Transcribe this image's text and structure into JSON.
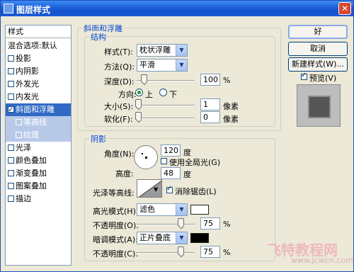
{
  "window": {
    "title": "图层样式"
  },
  "left_list": {
    "header": "样式",
    "items": [
      {
        "label": "混合选项:默认",
        "check": false
      },
      {
        "label": "投影",
        "check": true,
        "on": false
      },
      {
        "label": "内阴影",
        "check": true,
        "on": false
      },
      {
        "label": "外发光",
        "check": true,
        "on": false
      },
      {
        "label": "内发光",
        "check": true,
        "on": false
      },
      {
        "label": "斜面和浮雕",
        "check": true,
        "on": true,
        "selected": true
      },
      {
        "label": "等高线",
        "check": true,
        "on": false,
        "sub": true
      },
      {
        "label": "纹理",
        "check": true,
        "on": false,
        "sub": true
      },
      {
        "label": "光泽",
        "check": true,
        "on": false
      },
      {
        "label": "颜色叠加",
        "check": true,
        "on": false
      },
      {
        "label": "渐变叠加",
        "check": true,
        "on": false
      },
      {
        "label": "图案叠加",
        "check": true,
        "on": false
      },
      {
        "label": "描边",
        "check": true,
        "on": false
      }
    ]
  },
  "bevel": {
    "legend": "斜面和浮雕",
    "structure_legend": "结构",
    "style_label": "样式(T):",
    "style_value": "枕状浮雕",
    "technique_label": "方法(Q):",
    "technique_value": "平滑",
    "depth_label": "深度(D):",
    "depth_value": "100",
    "depth_unit": "%",
    "depth_level": 0.1,
    "direction_label": "方向:",
    "dir_up": "上",
    "dir_down": "下",
    "size_label": "大小(S):",
    "size_value": "1",
    "size_unit": "像素",
    "size_level": 0.0,
    "soften_label": "软化(F):",
    "soften_value": "0",
    "soften_unit": "像素",
    "soften_level": 0.0
  },
  "shading": {
    "legend": "阴影",
    "angle_label": "角度(N):",
    "angle_value": "120",
    "angle_unit": "度",
    "global_light_label": "使用全局光(G)",
    "global_light": false,
    "altitude_label": "高度:",
    "altitude_value": "48",
    "altitude_unit": "度",
    "gloss_label": "光泽等高线:",
    "anti_alias_label": "消除锯齿(L)",
    "anti_alias": true,
    "highlight_mode_label": "高光模式(H):",
    "highlight_mode_value": "滤色",
    "highlight_color": "#ffffff",
    "highlight_opacity_label": "不透明度(O):",
    "highlight_opacity_value": "75",
    "highlight_opacity_level": 0.75,
    "shadow_mode_label": "暗调模式(A):",
    "shadow_mode_value": "正片叠底",
    "shadow_color": "#000000",
    "shadow_opacity_label": "不透明度(C):",
    "shadow_opacity_value": "75",
    "shadow_opacity_level": 0.75,
    "percent": "%"
  },
  "buttons": {
    "ok": "好",
    "cancel": "取消",
    "new_style": "新建样式(W)...",
    "preview_label": "预览(V)",
    "preview_checked": true
  },
  "watermark": {
    "text1": "飞特教程网",
    "text2": "www.jcwcn.com"
  }
}
